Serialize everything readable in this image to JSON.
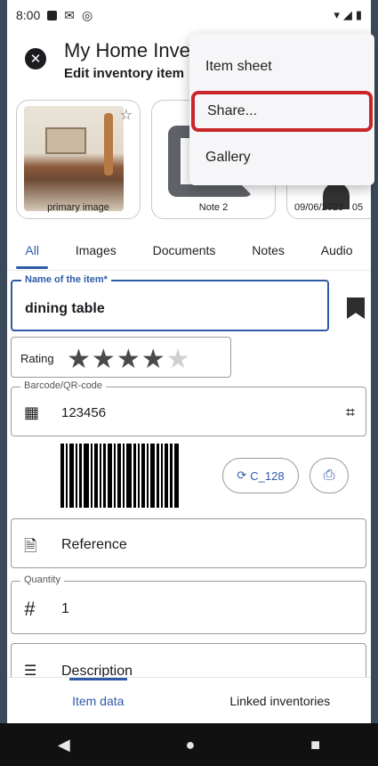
{
  "status_bar": {
    "time": "8:00"
  },
  "app_bar": {
    "title": "My Home Inve",
    "subtitle": "Edit inventory item"
  },
  "media": [
    {
      "label": "primary image"
    },
    {
      "label": "Note 2"
    },
    {
      "label": "09/06/2023 - 05"
    }
  ],
  "tabs": [
    "All",
    "Images",
    "Documents",
    "Notes",
    "Audio"
  ],
  "fields": {
    "name": {
      "label": "Name of the item*",
      "value": "dining table"
    },
    "rating": {
      "label": "Rating",
      "stars": 4,
      "max": 5
    },
    "barcode": {
      "label": "Barcode/QR-code",
      "value": "123456"
    },
    "barcode_type": "C_128",
    "reference": {
      "label": "Reference"
    },
    "quantity": {
      "label": "Quantity",
      "value": "1"
    },
    "description": {
      "label": "Description"
    }
  },
  "bottom_tabs": {
    "item_data": "Item data",
    "linked": "Linked inventories"
  },
  "menu": {
    "item_sheet": "Item sheet",
    "share": "Share...",
    "gallery": "Gallery"
  },
  "colors": {
    "accent": "#2f5aa8",
    "highlight": "#c8262b"
  }
}
